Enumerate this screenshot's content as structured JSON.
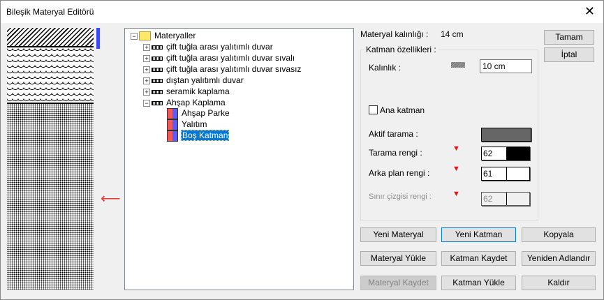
{
  "window": {
    "title": "Bileşik Materyal Editörü"
  },
  "tree": {
    "root": "Materyaller",
    "materials": [
      "çift tuğla arası yalıtımlı duvar",
      "çift tuğla arası yalıtımlı duvar sıvalı",
      "çift tuğla arası yalıtımlı duvar sıvasız",
      "dıştan yalıtımlı duvar",
      "seramik kaplama",
      "Ahşap Kaplama"
    ],
    "layers": [
      "Ahşap Parke",
      "Yalıtım",
      "Boş Katman"
    ]
  },
  "props": {
    "material_thickness_label": "Materyal kalınlığı :",
    "material_thickness_value": "14 cm",
    "group_label": "Katman özellikleri :",
    "thickness_label": "Kalınlık :",
    "thickness_value": "10 cm",
    "main_layer_label": "Ana katman",
    "main_layer_checked": false,
    "active_hatch_label": "Aktif tarama :",
    "hatch_color_label": "Tarama rengi :",
    "hatch_color_value": "62",
    "bg_color_label": "Arka plan rengi :",
    "bg_color_value": "61",
    "border_color_label": "Sınır çizgisi rengi :",
    "border_color_value": "62",
    "hatch_color": "#000000",
    "bg_color": "#ffffff"
  },
  "buttons": {
    "ok": "Tamam",
    "cancel": "İptal",
    "new_material": "Yeni Materyal",
    "new_layer": "Yeni Katman",
    "copy": "Kopyala",
    "load_material": "Materyal Yükle",
    "save_layer": "Katman Kaydet",
    "rename": "Yeniden Adlandır",
    "save_material": "Materyal Kaydet",
    "load_layer": "Katman Yükle",
    "remove": "Kaldır"
  }
}
